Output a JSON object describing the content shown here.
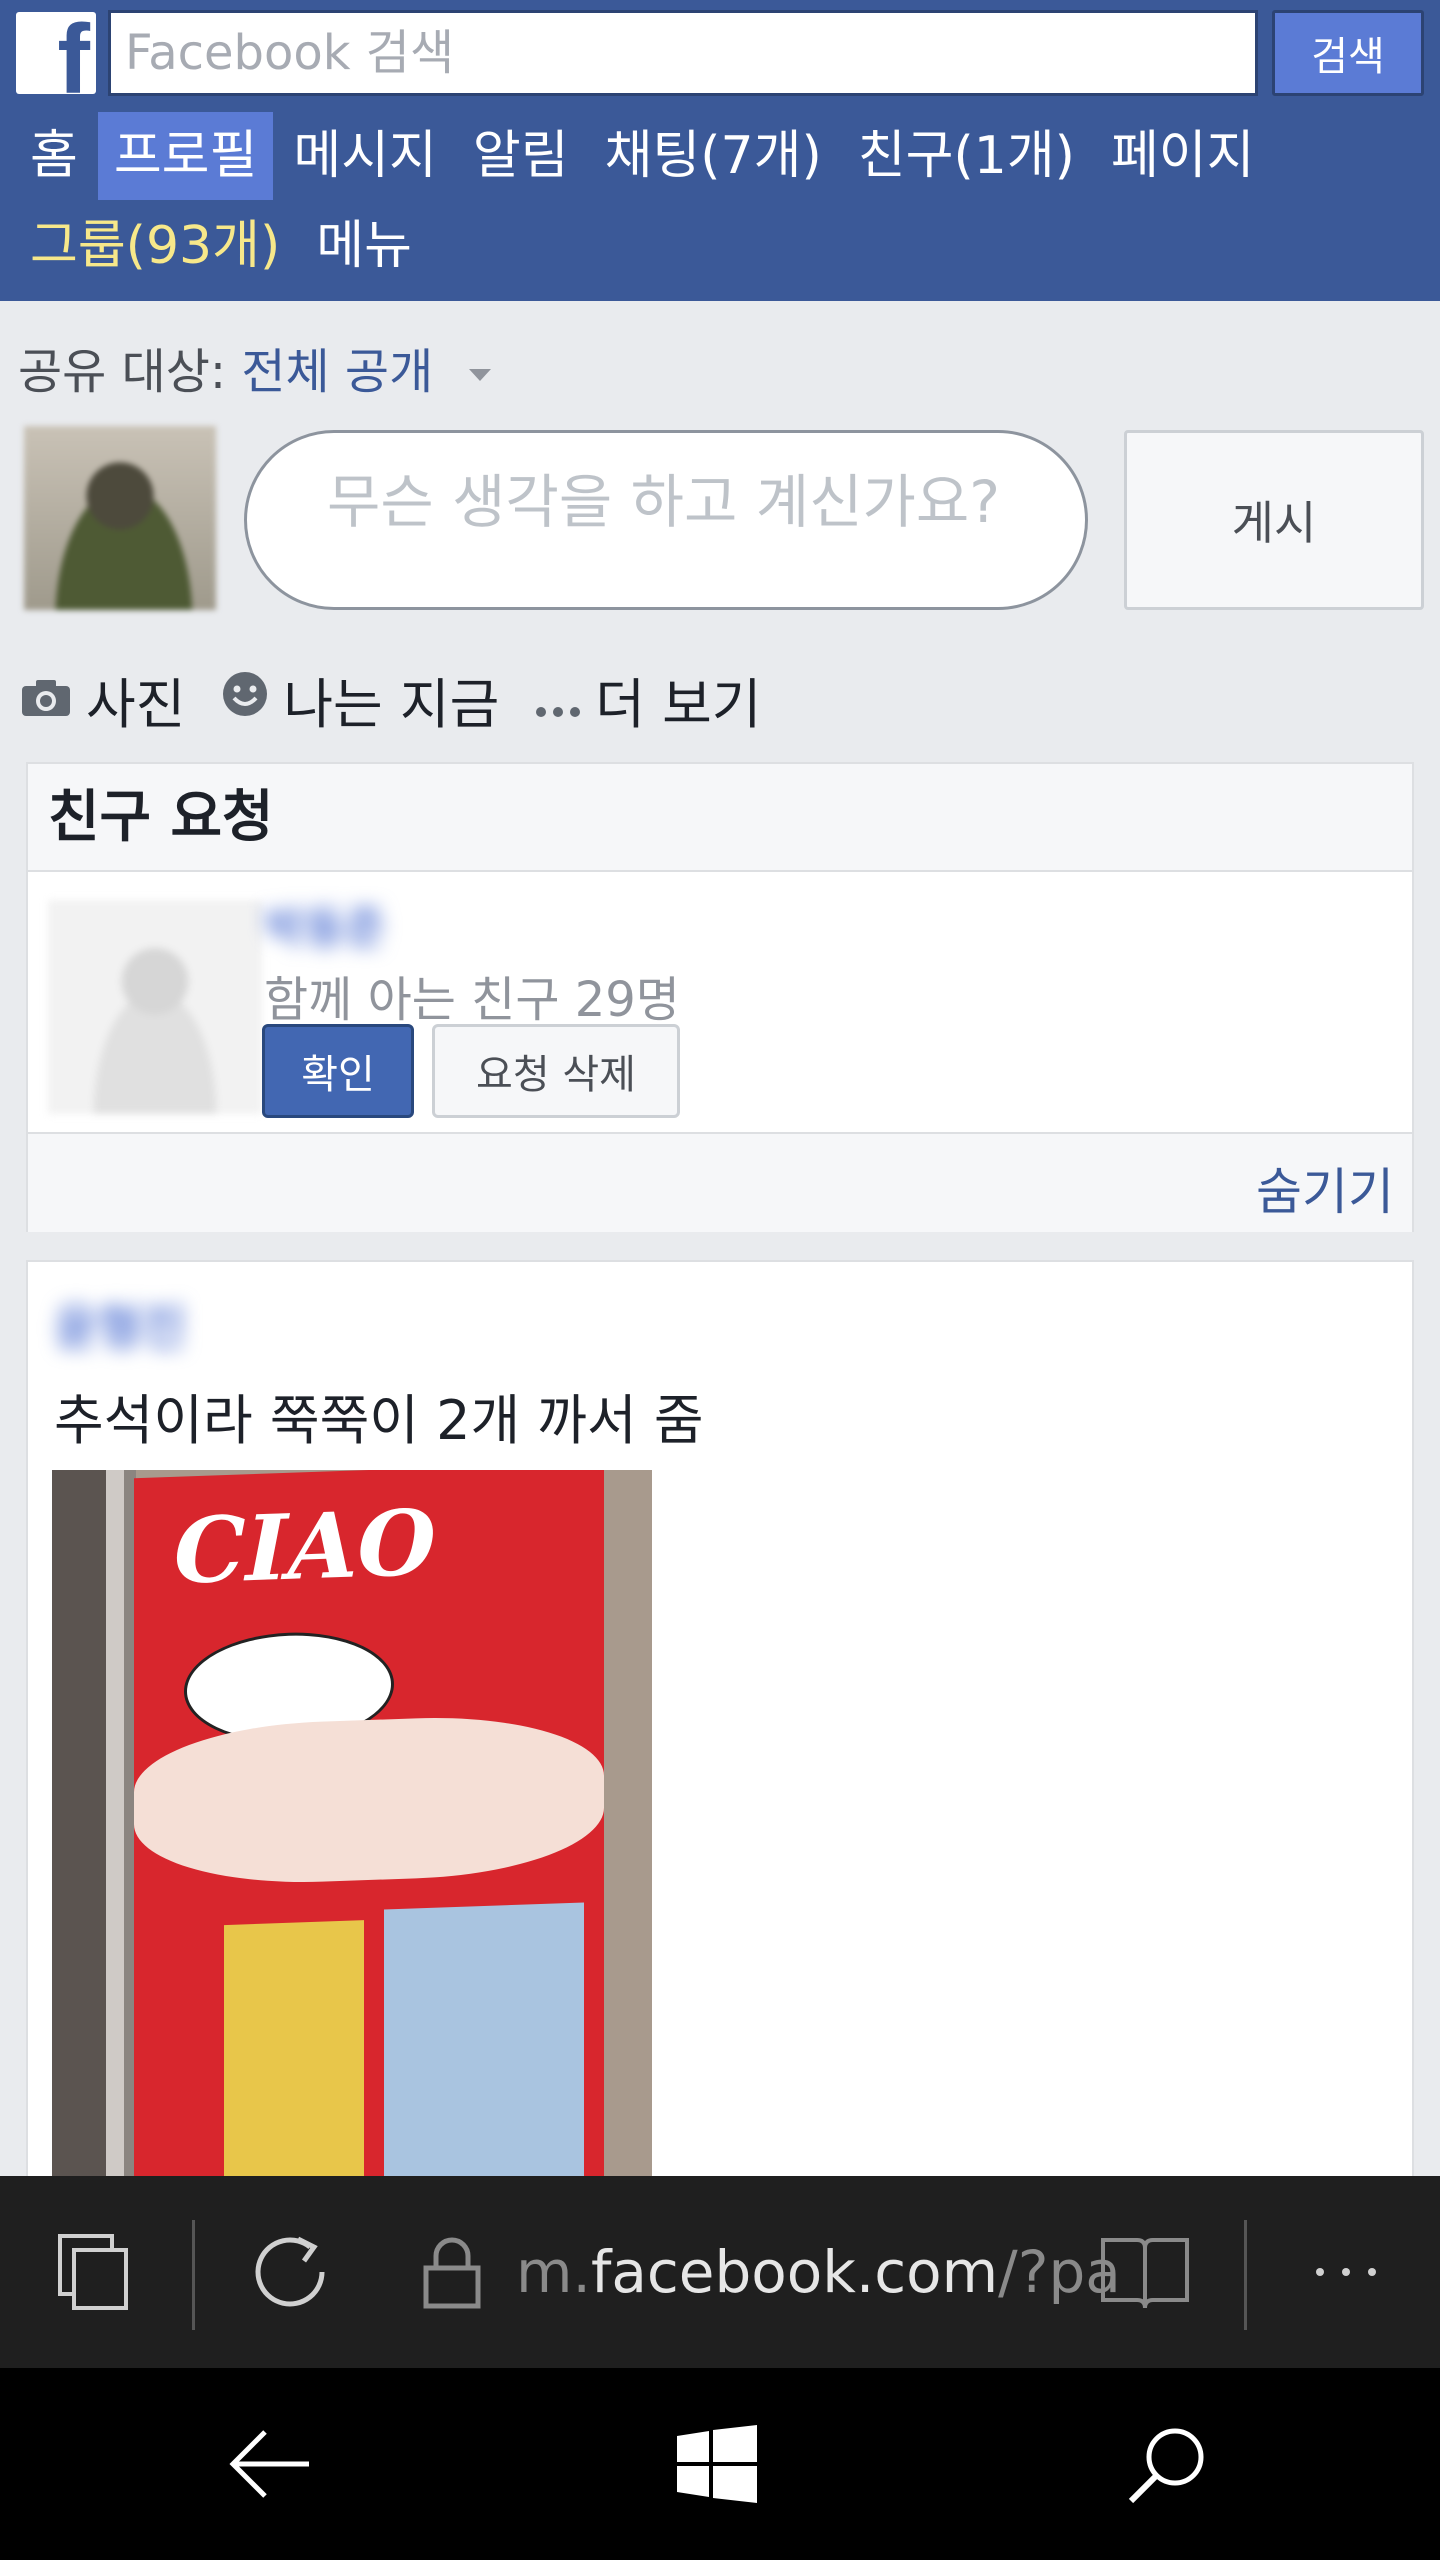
{
  "header": {
    "logo_letter": "f",
    "search_placeholder": "Facebook 검색",
    "search_button": "검색",
    "nav": [
      {
        "label": "홈"
      },
      {
        "label": "프로필"
      },
      {
        "label": "메시지"
      },
      {
        "label": "알림"
      },
      {
        "label": "채팅(7개)"
      },
      {
        "label": "친구(1개)"
      },
      {
        "label": "페이지"
      },
      {
        "label": "그룹(93개)"
      },
      {
        "label": "메뉴"
      }
    ],
    "active_nav": "프로필",
    "colors": {
      "bar": "#3b5998",
      "active": "#5b7bd5",
      "groups_highlight": "#f7e88a"
    }
  },
  "composer": {
    "privacy_label": "공유 대상:",
    "privacy_value": "전체 공개",
    "placeholder": "무슨 생각을 하고 계신가요?",
    "post_button": "게시",
    "actions": [
      {
        "label": "사진",
        "icon": "camera-icon"
      },
      {
        "label": "나는 지금",
        "icon": "smiley-icon"
      },
      {
        "label": "더 보기",
        "icon": "more-dots-icon"
      }
    ]
  },
  "friend_requests": {
    "title": "친구 요청",
    "name": "박동준",
    "mutual": "함께 아는 친구 29명",
    "confirm": "확인",
    "delete": "요청 삭제",
    "hide": "숨기기"
  },
  "post": {
    "author": "윤형진",
    "text": "추석이라 쭉쭉이 2개 까서 줌",
    "photo_label": "CIAO"
  },
  "browser": {
    "url_prefix": "m.",
    "url_domain": "facebook.com",
    "url_rest": "/?pa",
    "icons": [
      "tabs-icon",
      "refresh-icon",
      "lock-icon",
      "reading-view-icon",
      "more-options-icon"
    ]
  },
  "system_nav": {
    "icons": [
      "back-arrow-icon",
      "windows-start-icon",
      "search-icon"
    ]
  }
}
